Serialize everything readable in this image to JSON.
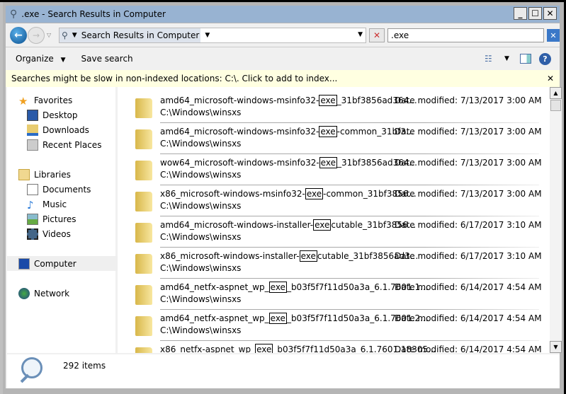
{
  "window": {
    "title": ".exe - Search Results in Computer",
    "minimize": "_",
    "maximize": "☐",
    "close": "✕"
  },
  "address": {
    "location": "Search Results in Computer"
  },
  "search": {
    "value": ".exe"
  },
  "toolbar": {
    "organize": "Organize",
    "save_search": "Save search"
  },
  "infobar": {
    "text": "Searches might be slow in non-indexed locations: C:\\. Click to add to index...",
    "close": "✕"
  },
  "sidebar": {
    "favorites": {
      "label": "Favorites",
      "items": [
        {
          "label": "Desktop"
        },
        {
          "label": "Downloads"
        },
        {
          "label": "Recent Places"
        }
      ]
    },
    "libraries": {
      "label": "Libraries",
      "items": [
        {
          "label": "Documents"
        },
        {
          "label": "Music"
        },
        {
          "label": "Pictures"
        },
        {
          "label": "Videos"
        }
      ]
    },
    "computer": {
      "label": "Computer"
    },
    "network": {
      "label": "Network"
    }
  },
  "results": [
    {
      "pre": "amd64_microsoft-windows-msinfo32-",
      "match": "exe",
      "post": "_31bf3856ad364...",
      "path": "C:\\Windows\\winsxs",
      "date": "Date modified: 7/13/2017 3:00 AM"
    },
    {
      "pre": "amd64_microsoft-windows-msinfo32-",
      "match": "exe",
      "post": "-common_31bf3...",
      "path": "C:\\Windows\\winsxs",
      "date": "Date modified: 7/13/2017 3:00 AM"
    },
    {
      "pre": "wow64_microsoft-windows-msinfo32-",
      "match": "exe",
      "post": "_31bf3856ad364...",
      "path": "C:\\Windows\\winsxs",
      "date": "Date modified: 7/13/2017 3:00 AM"
    },
    {
      "pre": "x86_microsoft-windows-msinfo32-",
      "match": "exe",
      "post": "-common_31bf3856...",
      "path": "C:\\Windows\\winsxs",
      "date": "Date modified: 7/13/2017 3:00 AM"
    },
    {
      "pre": "amd64_microsoft-windows-installer-",
      "match": "exe",
      "post": "cutable_31bf3856...",
      "path": "C:\\Windows\\winsxs",
      "date": "Date modified: 6/17/2017 3:10 AM"
    },
    {
      "pre": "x86_microsoft-windows-installer-",
      "match": "exe",
      "post": "cutable_31bf3856ad3...",
      "path": "C:\\Windows\\winsxs",
      "date": "Date modified: 6/17/2017 3:10 AM"
    },
    {
      "pre": "amd64_netfx-aspnet_wp_",
      "match": "exe",
      "post": "_b03f5f7f11d50a3a_6.1.7601.1...",
      "path": "C:\\Windows\\winsxs",
      "date": "Date modified: 6/14/2017 4:54 AM"
    },
    {
      "pre": "amd64_netfx-aspnet_wp_",
      "match": "exe",
      "post": "_b03f5f7f11d50a3a_6.1.7601.2...",
      "path": "C:\\Windows\\winsxs",
      "date": "Date modified: 6/14/2017 4:54 AM"
    },
    {
      "pre": "x86_netfx-aspnet_wp_",
      "match": "exe",
      "post": "_b03f5f7f11d50a3a_6.1.7601.18305...",
      "path": "",
      "date": "Date modified: 6/14/2017 4:54 AM"
    }
  ],
  "status": {
    "count": "292 items"
  }
}
